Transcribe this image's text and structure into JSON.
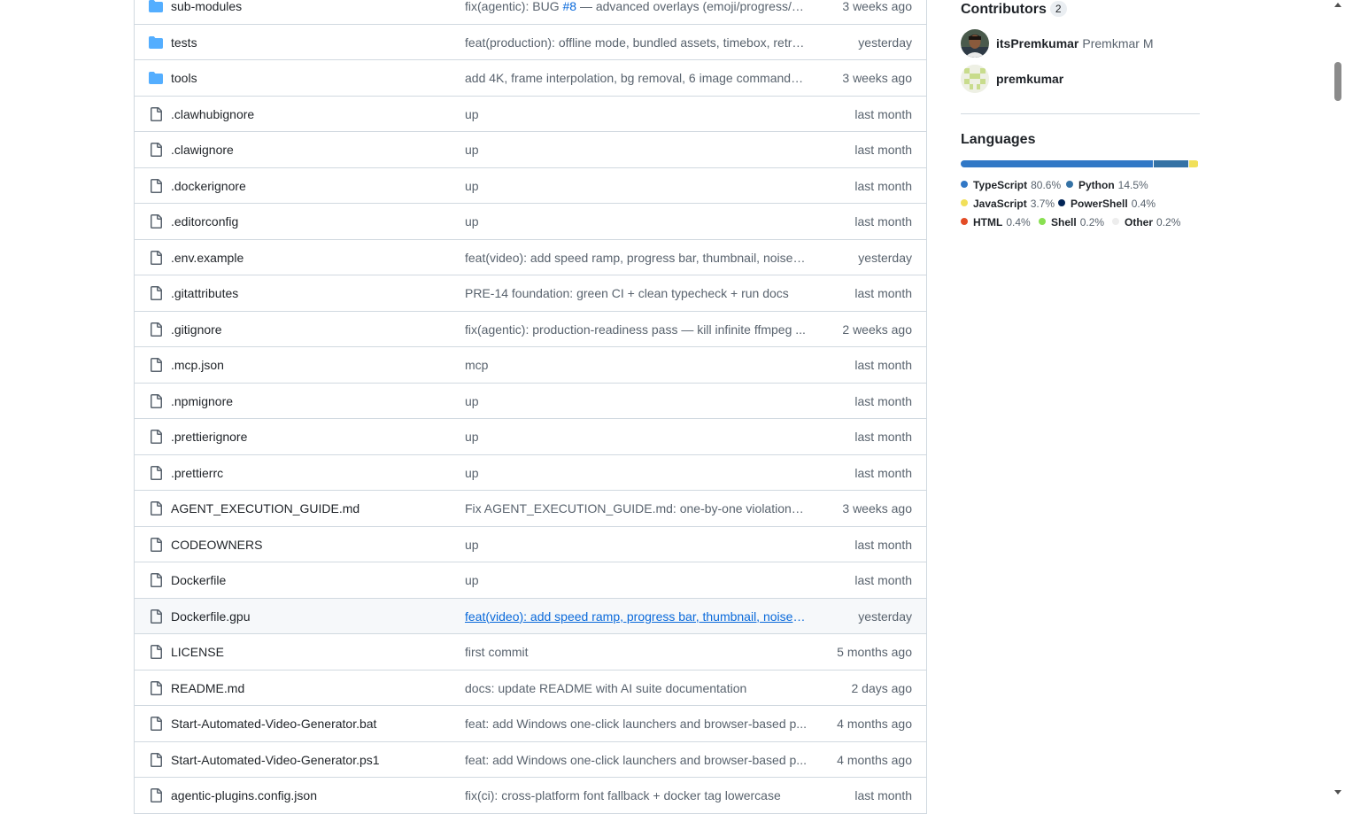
{
  "files": [
    {
      "type": "dir",
      "name": "sub-modules",
      "message_before": "fix(agentic): BUG ",
      "message_issue": "#8",
      "message_after": " — advanced overlays (emoji/progress/ki...",
      "date": "3 weeks ago"
    },
    {
      "type": "dir",
      "name": "tests",
      "message": "feat(production): offline mode, bundled assets, timebox, retry...",
      "date": "yesterday"
    },
    {
      "type": "dir",
      "name": "tools",
      "message": "add 4K, frame interpolation, bg removal, 6 image commands,...",
      "date": "3 weeks ago"
    },
    {
      "type": "file",
      "name": ".clawhubignore",
      "message": "up",
      "date": "last month"
    },
    {
      "type": "file",
      "name": ".clawignore",
      "message": "up",
      "date": "last month"
    },
    {
      "type": "file",
      "name": ".dockerignore",
      "message": "up",
      "date": "last month"
    },
    {
      "type": "file",
      "name": ".editorconfig",
      "message": "up",
      "date": "last month"
    },
    {
      "type": "file",
      "name": ".env.example",
      "message": "feat(video): add speed ramp, progress bar, thumbnail, noise r...",
      "date": "yesterday"
    },
    {
      "type": "file",
      "name": ".gitattributes",
      "message": "PRE-14 foundation: green CI + clean typecheck + run docs",
      "date": "last month"
    },
    {
      "type": "file",
      "name": ".gitignore",
      "message": "fix(agentic): production-readiness pass — kill infinite ffmpeg ...",
      "date": "2 weeks ago"
    },
    {
      "type": "file",
      "name": ".mcp.json",
      "message": "mcp",
      "date": "last month"
    },
    {
      "type": "file",
      "name": ".npmignore",
      "message": "up",
      "date": "last month"
    },
    {
      "type": "file",
      "name": ".prettierignore",
      "message": "up",
      "date": "last month"
    },
    {
      "type": "file",
      "name": ".prettierrc",
      "message": "up",
      "date": "last month"
    },
    {
      "type": "file",
      "name": "AGENT_EXECUTION_GUIDE.md",
      "message": "Fix AGENT_EXECUTION_GUIDE.md: one-by-one violations, ag...",
      "date": "3 weeks ago"
    },
    {
      "type": "file",
      "name": "CODEOWNERS",
      "message": "up",
      "date": "last month"
    },
    {
      "type": "file",
      "name": "Dockerfile",
      "message": "up",
      "date": "last month"
    },
    {
      "type": "file",
      "name": "Dockerfile.gpu",
      "message": "feat(video): add speed ramp, progress bar, thumbnail, noise r...",
      "date": "yesterday",
      "hover": true
    },
    {
      "type": "file",
      "name": "LICENSE",
      "message": "first commit",
      "date": "5 months ago"
    },
    {
      "type": "file",
      "name": "README.md",
      "message": "docs: update README with AI suite documentation",
      "date": "2 days ago"
    },
    {
      "type": "file",
      "name": "Start-Automated-Video-Generator.bat",
      "message": "feat: add Windows one-click launchers and browser-based p...",
      "date": "4 months ago"
    },
    {
      "type": "file",
      "name": "Start-Automated-Video-Generator.ps1",
      "message": "feat: add Windows one-click launchers and browser-based p...",
      "date": "4 months ago"
    },
    {
      "type": "file",
      "name": "agentic-plugins.config.json",
      "message": "fix(ci): cross-platform font fallback + docker tag lowercase",
      "date": "last month"
    }
  ],
  "sidebar": {
    "contributors": {
      "heading": "Contributors",
      "count": "2",
      "people": [
        {
          "login": "itsPremkumar",
          "name": "Premkmar M"
        },
        {
          "login": "premkumar",
          "name": ""
        }
      ]
    },
    "languages": {
      "heading": "Languages",
      "items": [
        {
          "name": "TypeScript",
          "percent": "80.6%",
          "value": 80.6,
          "color": "#3178c6"
        },
        {
          "name": "Python",
          "percent": "14.5%",
          "value": 14.5,
          "color": "#3572a5"
        },
        {
          "name": "JavaScript",
          "percent": "3.7%",
          "value": 3.7,
          "color": "#f1e05a"
        },
        {
          "name": "PowerShell",
          "percent": "0.4%",
          "value": 0.4,
          "color": "#012456"
        },
        {
          "name": "HTML",
          "percent": "0.4%",
          "value": 0.4,
          "color": "#e34c26"
        },
        {
          "name": "Shell",
          "percent": "0.2%",
          "value": 0.2,
          "color": "#89e051"
        },
        {
          "name": "Other",
          "percent": "0.2%",
          "value": 0.2,
          "color": "#ededed"
        }
      ]
    }
  },
  "colors": {
    "link": "#0969da",
    "border": "#d1d9e0",
    "folder": "#54aeff",
    "muted": "#59636e"
  }
}
